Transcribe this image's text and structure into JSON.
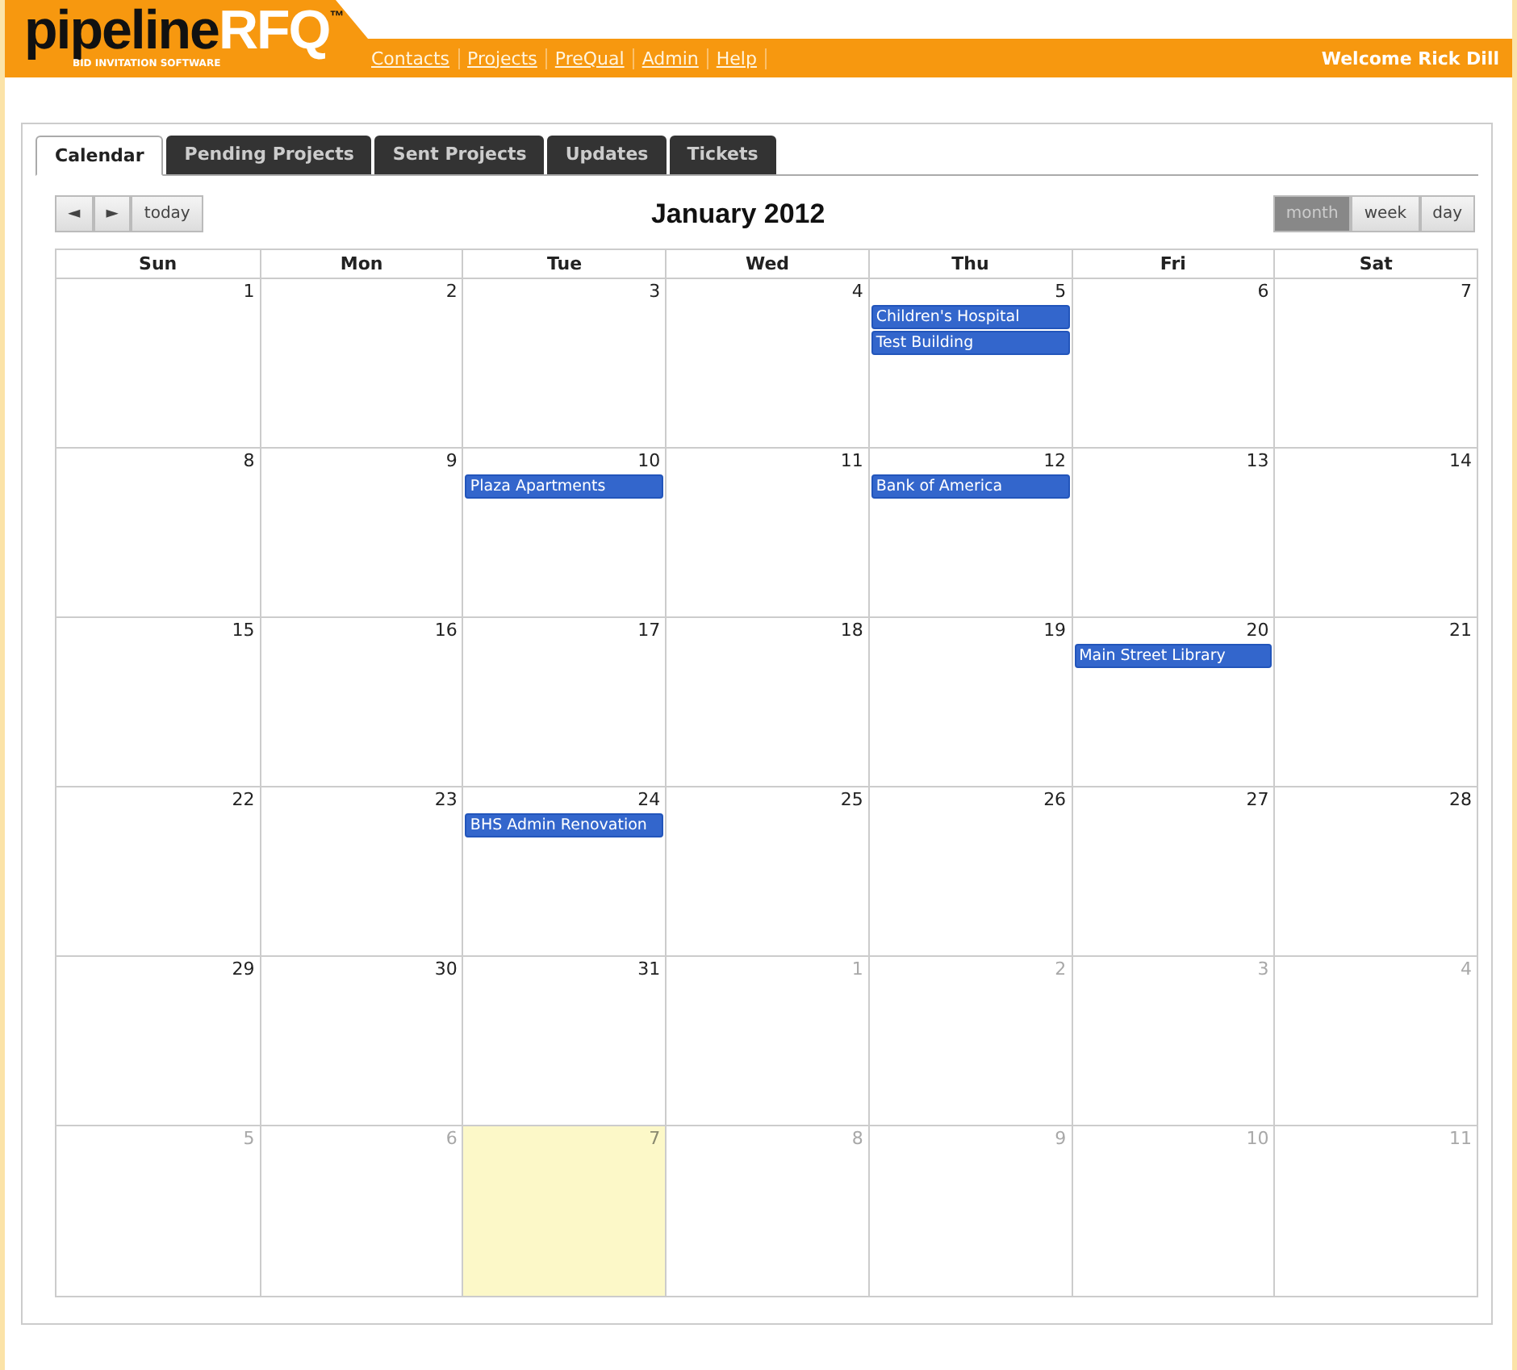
{
  "header": {
    "logo_dark": "pipeline",
    "logo_light": "RFQ",
    "logo_mark": "™",
    "tagline": "BID INVITATION SOFTWARE",
    "nav": [
      "Contacts",
      "Projects",
      "PreQual",
      "Admin",
      "Help"
    ],
    "welcome": "Welcome Rick Dill"
  },
  "tabs": [
    {
      "label": "Calendar",
      "selected": true
    },
    {
      "label": "Pending Projects",
      "selected": false
    },
    {
      "label": "Sent Projects",
      "selected": false
    },
    {
      "label": "Updates",
      "selected": false
    },
    {
      "label": "Tickets",
      "selected": false
    }
  ],
  "toolbar": {
    "prev": "◄",
    "next": "►",
    "today": "today",
    "title": "January 2012",
    "views": [
      {
        "label": "month",
        "selected": true
      },
      {
        "label": "week",
        "selected": false
      },
      {
        "label": "day",
        "selected": false
      }
    ]
  },
  "weekdays": [
    "Sun",
    "Mon",
    "Tue",
    "Wed",
    "Thu",
    "Fri",
    "Sat"
  ],
  "weeks": [
    [
      {
        "day": "1",
        "other_month": false,
        "today": false
      },
      {
        "day": "2",
        "other_month": false,
        "today": false
      },
      {
        "day": "3",
        "other_month": false,
        "today": false
      },
      {
        "day": "4",
        "other_month": false,
        "today": false
      },
      {
        "day": "5",
        "other_month": false,
        "today": false,
        "events": [
          "Children's Hospital",
          "Test Building"
        ]
      },
      {
        "day": "6",
        "other_month": false,
        "today": false
      },
      {
        "day": "7",
        "other_month": false,
        "today": false
      }
    ],
    [
      {
        "day": "8",
        "other_month": false,
        "today": false
      },
      {
        "day": "9",
        "other_month": false,
        "today": false
      },
      {
        "day": "10",
        "other_month": false,
        "today": false,
        "events": [
          "Plaza Apartments"
        ]
      },
      {
        "day": "11",
        "other_month": false,
        "today": false
      },
      {
        "day": "12",
        "other_month": false,
        "today": false,
        "events": [
          "Bank of America"
        ]
      },
      {
        "day": "13",
        "other_month": false,
        "today": false
      },
      {
        "day": "14",
        "other_month": false,
        "today": false
      }
    ],
    [
      {
        "day": "15",
        "other_month": false,
        "today": false
      },
      {
        "day": "16",
        "other_month": false,
        "today": false
      },
      {
        "day": "17",
        "other_month": false,
        "today": false
      },
      {
        "day": "18",
        "other_month": false,
        "today": false
      },
      {
        "day": "19",
        "other_month": false,
        "today": false
      },
      {
        "day": "20",
        "other_month": false,
        "today": false,
        "events": [
          "Main Street Library"
        ]
      },
      {
        "day": "21",
        "other_month": false,
        "today": false
      }
    ],
    [
      {
        "day": "22",
        "other_month": false,
        "today": false
      },
      {
        "day": "23",
        "other_month": false,
        "today": false
      },
      {
        "day": "24",
        "other_month": false,
        "today": false,
        "events": [
          "BHS Admin Renovation"
        ]
      },
      {
        "day": "25",
        "other_month": false,
        "today": false
      },
      {
        "day": "26",
        "other_month": false,
        "today": false
      },
      {
        "day": "27",
        "other_month": false,
        "today": false
      },
      {
        "day": "28",
        "other_month": false,
        "today": false
      }
    ],
    [
      {
        "day": "29",
        "other_month": false,
        "today": false
      },
      {
        "day": "30",
        "other_month": false,
        "today": false
      },
      {
        "day": "31",
        "other_month": false,
        "today": false
      },
      {
        "day": "1",
        "other_month": true,
        "today": false
      },
      {
        "day": "2",
        "other_month": true,
        "today": false
      },
      {
        "day": "3",
        "other_month": true,
        "today": false
      },
      {
        "day": "4",
        "other_month": true,
        "today": false
      }
    ],
    [
      {
        "day": "5",
        "other_month": true,
        "today": false
      },
      {
        "day": "6",
        "other_month": true,
        "today": false
      },
      {
        "day": "7",
        "other_month": true,
        "today": true
      },
      {
        "day": "8",
        "other_month": true,
        "today": false
      },
      {
        "day": "9",
        "other_month": true,
        "today": false
      },
      {
        "day": "10",
        "other_month": true,
        "today": false
      },
      {
        "day": "11",
        "other_month": true,
        "today": false
      }
    ]
  ]
}
